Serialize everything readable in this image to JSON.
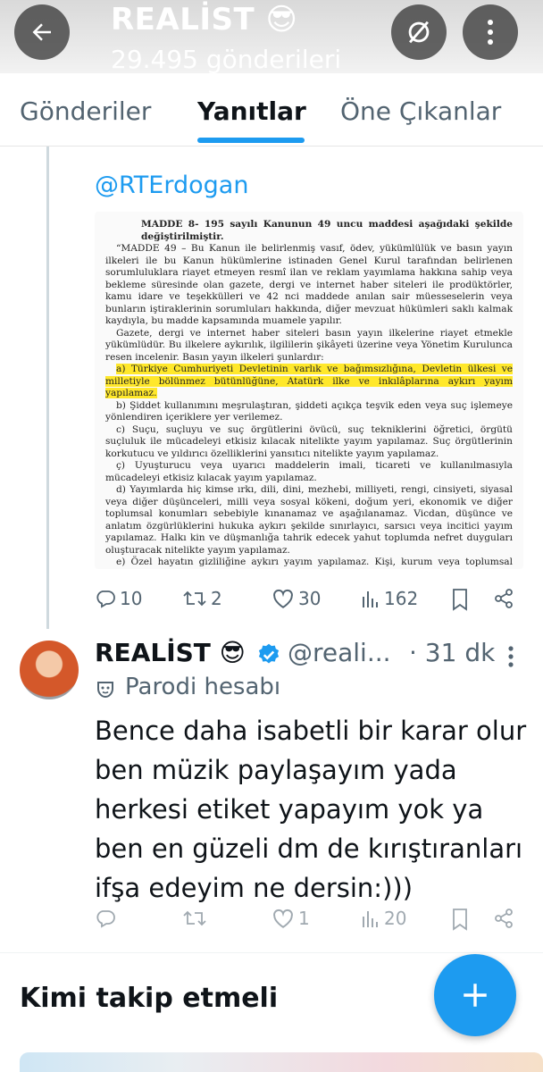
{
  "header": {
    "title": "REALİST 😎",
    "subtitle": "29.495 gönderileri"
  },
  "tabs": [
    {
      "label": "Gönderiler"
    },
    {
      "label": "Yanıtlar"
    },
    {
      "label": "Öne Çıkanlar"
    }
  ],
  "active_tab": "Yanıtlar",
  "quoted_tweet": {
    "mention": "@RTErdogan",
    "document": {
      "heading": "MADDE 8- 195 sayılı Kanunun 49 uncu maddesi aşağıdaki şekilde değiştirilmiştir.",
      "paragraphs": [
        "“MADDE 49 – Bu Kanun ile belirlenmiş vasıf, ödev, yükümlülük ve basın yayın ilkeleri ile bu Kanun hükümlerine istinaden Genel Kurul tarafından belirlenen sorumluluklara riayet etmeyen resmî ilan ve reklam yayımlama hakkına sahip veya bekleme süresinde olan gazete, dergi ve internet haber siteleri ile prodüktörler, kamu idare ve teşekkülleri ve 42 nci maddede anılan sair müesseselerin veya bunların iştiraklerinin sorumluları hakkında, diğer mevzuat hükümleri saklı kalmak kaydıyla, bu madde kapsamında muamele yapılır.",
        "Gazete, dergi ve internet haber siteleri basın yayın ilkelerine riayet etmekle yükümlüdür. Bu ilkelere aykırılık, ilgililerin şikâyeti üzerine veya Yönetim Kurulunca resen incelenir. Basın yayın ilkeleri şunlardır:"
      ],
      "highlighted": "a) Türkiye Cumhuriyeti Devletinin varlık ve bağımsızlığına, Devletin ülkesi ve milletiyle bölünmez bütünlüğüne, Atatürk ilke ve inkılâplarına aykırı yayım yapılamaz.",
      "items": [
        "b) Şiddet kullanımını meşrulaştıran, şiddeti açıkça teşvik eden veya suç işlemeye yönlendiren içeriklere yer verilemez.",
        "c) Suçu, suçluyu ve suç örgütlerini övücü, suç tekniklerini öğretici, örgütü suçluluk ile mücadeleyi etkisiz kılacak nitelikte yayım yapılamaz. Suç örgütlerinin korkutucu ve yıldırıcı özelliklerini yansıtıcı nitelikte yayım yapılamaz.",
        "ç) Uyuşturucu veya uyarıcı maddelerin imali, ticareti ve kullanılmasıyla mücadeleyi etkisiz kılacak yayım yapılamaz.",
        "d) Yayımlarda hiç kimse ırkı, dili, dini, mezhebi, milliyeti, rengi, cinsiyeti, siyasal veya diğer düşünceleri, milli veya sosyal kökeni, doğum yeri, ekonomik ve diğer toplumsal konumları sebebiyle kınanamaz ve aşağılanamaz. Vicdan, düşünce ve anlatım özgürlüklerini hukuka aykırı şekilde sınırlayıcı, sarsıcı veya incitici yayım yapılamaz. Halkı kin ve düşmanlığa tahrik edecek yahut toplumda nefret duyguları oluşturacak nitelikte yayım yapılamaz.",
        "e) Özel hayatın gizliliğine aykırı yayım yapılamaz. Kişi, kurum veya toplumsal gruplara yönelik yayımlarda, kişinin, kurumun veya grubun onur, şeref ve saygınlığını rencide edecek sözcükler kullanılamaz; hakaret edilemez, sövülemez, iftira ve haksız isnatlarda bulunulamaz."
      ]
    },
    "stats": {
      "replies": "10",
      "reposts": "2",
      "likes": "30",
      "views": "162"
    }
  },
  "reply_tweet": {
    "name": "REALİST 😎",
    "handle": "@reali...",
    "time": "· 31 dk",
    "parody_label": "Parodi hesabı",
    "text": "Bence daha isabetli bir karar olur ben müzik paylaşayım yada herkesi etiket yapayım yok ya ben en güzeli dm de kırıştıranları ifşa edeyim ne dersin:)))",
    "stats": {
      "likes": "1",
      "views": "20"
    }
  },
  "section": {
    "who_to_follow": "Kimi takip etmeli"
  },
  "colors": {
    "accent": "#1d9bf0",
    "muted": "#536471",
    "highlight": "#ffe82b"
  }
}
